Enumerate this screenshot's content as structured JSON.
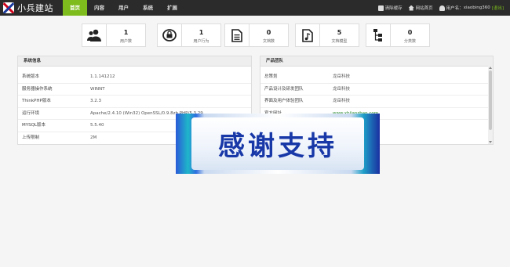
{
  "header": {
    "site_name": "小兵建站",
    "nav": [
      "首页",
      "内容",
      "用户",
      "系统",
      "扩展"
    ],
    "clear_cache": "清除缓存",
    "site_home": "网站首页",
    "user_label": "用户名：",
    "username": "xiaobing360",
    "logout": "[退出]"
  },
  "stats": [
    {
      "icon": "users-icon",
      "value": "1",
      "label": "用户数"
    },
    {
      "icon": "user-action-icon",
      "value": "1",
      "label": "用户行为"
    },
    {
      "icon": "document-icon",
      "value": "0",
      "label": "文档数"
    },
    {
      "icon": "music-file-icon",
      "value": "5",
      "label": "文档模型"
    },
    {
      "icon": "sitemap-icon",
      "value": "0",
      "label": "分类数"
    }
  ],
  "system_info": {
    "title": "系统信息",
    "rows": [
      {
        "key": "系统版本",
        "value": "1.1.141212"
      },
      {
        "key": "服务器操作系统",
        "value": "WINNT"
      },
      {
        "key": "ThinkPHP版本",
        "value": "3.2.3"
      },
      {
        "key": "运行环境",
        "value": "Apache/2.4.10 (Win32) OpenSSL/0.9.8zb PHP/5.3.29"
      },
      {
        "key": "MYSQL版本",
        "value": "5.5.40"
      },
      {
        "key": "上传限制",
        "value": "2M"
      }
    ]
  },
  "product_team": {
    "title": "产品团队",
    "rows": [
      {
        "key": "总策划",
        "value": "龙岳科技"
      },
      {
        "key": "产品设计及研发团队",
        "value": "龙岳科技"
      },
      {
        "key": "界面及用户体验团队",
        "value": "龙岳科技"
      },
      {
        "key": "官方网址",
        "value": "www.xbjianzhan.com"
      }
    ]
  },
  "banner": {
    "text": "感谢支持"
  },
  "colors": {
    "accent": "#7dbc1c",
    "topbar": "#2b2b2b",
    "banner_text": "#1838a8"
  }
}
